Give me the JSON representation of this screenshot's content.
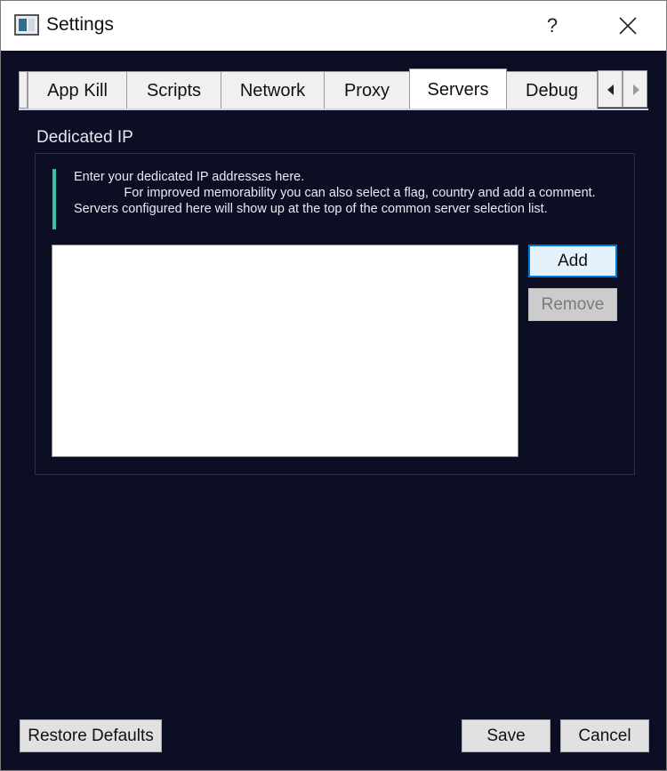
{
  "window": {
    "title": "Settings",
    "help_label": "?"
  },
  "tabs": [
    {
      "label": "App Kill"
    },
    {
      "label": "Scripts"
    },
    {
      "label": "Network"
    },
    {
      "label": "Proxy"
    },
    {
      "label": "Servers",
      "active": true
    },
    {
      "label": "Debug"
    }
  ],
  "tab_scroll": {
    "left_icon": "triangle-left-icon",
    "right_icon": "triangle-right-icon"
  },
  "dedicated_ip": {
    "group_title": "Dedicated IP",
    "description": "Enter your dedicated IP addresses here.\n              For improved memorability you can also select a flag, country and add a comment. Servers configured here will show up at the top of the common server selection list.",
    "accent_color": "#3bbfa3",
    "entries": [],
    "add_label": "Add",
    "remove_label": "Remove",
    "remove_enabled": false
  },
  "footer": {
    "restore_label": "Restore Defaults",
    "save_label": "Save",
    "cancel_label": "Cancel"
  },
  "colors": {
    "background": "#0c0f24",
    "text": "#e8eaf2"
  }
}
